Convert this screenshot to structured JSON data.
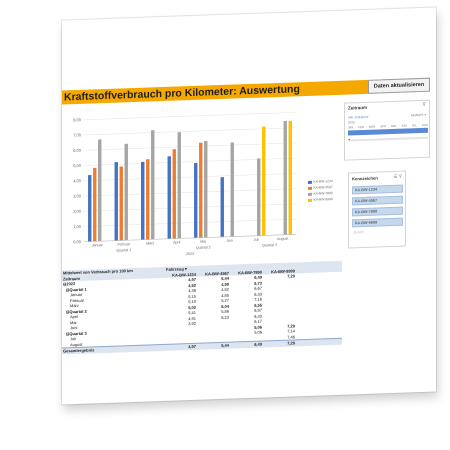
{
  "title": "Kraftstoffverbrauch pro Kilometer: Auswertung",
  "refresh_button": "Daten aktualisieren",
  "colors": {
    "accent": "#f5a800",
    "series": [
      "#4472c4",
      "#ed7d31",
      "#a5a5a5",
      "#ffc000"
    ]
  },
  "chart_data": {
    "type": "bar",
    "categories": [
      "Januar",
      "Februar",
      "März",
      "April",
      "Mai",
      "Juni",
      "Juli",
      "August"
    ],
    "group_labels": [
      {
        "label": "Quartal 1",
        "from": 0,
        "to": 2
      },
      {
        "label": "Quartal 2",
        "from": 3,
        "to": 5
      },
      {
        "label": "Quartal 3",
        "from": 6,
        "to": 7
      }
    ],
    "year_label": "2023",
    "ylim": [
      0,
      8
    ],
    "yticks": [
      "0,00",
      "1,00",
      "2,00",
      "3,00",
      "4,00",
      "5,00",
      "6,00",
      "7,00",
      "8,00"
    ],
    "series": [
      {
        "name": "KA-BW-1234",
        "values": [
          4.36,
          5.15,
          5.1,
          5.41,
          4.91,
          3.92,
          null,
          null
        ]
      },
      {
        "name": "KA-BW-4567",
        "values": [
          4.82,
          4.85,
          5.27,
          5.86,
          6.23,
          null,
          null,
          null
        ]
      },
      {
        "name": "KA-BW-7890",
        "values": [
          6.67,
          6.33,
          7.16,
          6.97,
          6.33,
          6.17,
          5.06,
          7.46
        ]
      },
      {
        "name": "KA-BW-9999",
        "values": [
          null,
          null,
          null,
          null,
          null,
          null,
          7.14,
          7.46
        ]
      }
    ],
    "grid": true,
    "legend": "right"
  },
  "timeline": {
    "title": "Zeitraum",
    "range": "Alle Zeiträume",
    "level": "MONATE ▾",
    "year": "2023",
    "months": [
      "JAN",
      "FEB",
      "MÄR",
      "APR",
      "MAI",
      "JUN",
      "JUL",
      "AUG"
    ]
  },
  "slicer": {
    "title": "Kennzeichen",
    "items": [
      "KA-BW-1234",
      "KA-BW-4567",
      "KA-BW-7890",
      "KA-BW-9999"
    ],
    "empty": "(Leer)"
  },
  "pivot": {
    "header1": "Mittelwert von Verbrauch pro 100 km",
    "header1_col": "Fahrzeug ▾",
    "header2": "Zeitraum",
    "columns": [
      "KA-BW-1234",
      "KA-BW-4567",
      "KA-BW-7890",
      "KA-BW-9999"
    ],
    "rows": [
      {
        "label": "⊟2023",
        "vals": [
          "4,97",
          "5,44",
          "6,49",
          "7,29"
        ],
        "bold": true
      },
      {
        "label": "⊟Quartal 1",
        "vals": [
          "4,92",
          "4,99",
          "6,73",
          ""
        ],
        "bold": true
      },
      {
        "label": "Januar",
        "vals": [
          "4,36",
          "4,82",
          "6,67",
          ""
        ],
        "bold": false
      },
      {
        "label": "Februar",
        "vals": [
          "5,15",
          "4,85",
          "6,33",
          ""
        ],
        "bold": false
      },
      {
        "label": "März",
        "vals": [
          "5,10",
          "5,27",
          "7,16",
          ""
        ],
        "bold": false
      },
      {
        "label": "⊟Quartal 2",
        "vals": [
          "5,02",
          "6,04",
          "6,55",
          ""
        ],
        "bold": true
      },
      {
        "label": "April",
        "vals": [
          "5,41",
          "5,86",
          "6,97",
          ""
        ],
        "bold": false
      },
      {
        "label": "Mai",
        "vals": [
          "4,91",
          "6,23",
          "6,33",
          ""
        ],
        "bold": false
      },
      {
        "label": "Juni",
        "vals": [
          "3,92",
          "",
          "6,17",
          ""
        ],
        "bold": false
      },
      {
        "label": "⊟Quartal 3",
        "vals": [
          "",
          "",
          "5,06",
          "7,29"
        ],
        "bold": true
      },
      {
        "label": "Juli",
        "vals": [
          "",
          "",
          "5,06",
          "7,14"
        ],
        "bold": false
      },
      {
        "label": "August",
        "vals": [
          "",
          "",
          "",
          "7,46"
        ],
        "bold": false
      }
    ],
    "total": {
      "label": "Gesamtergebnis",
      "vals": [
        "4,97",
        "5,44",
        "6,49",
        "7,29"
      ]
    }
  }
}
